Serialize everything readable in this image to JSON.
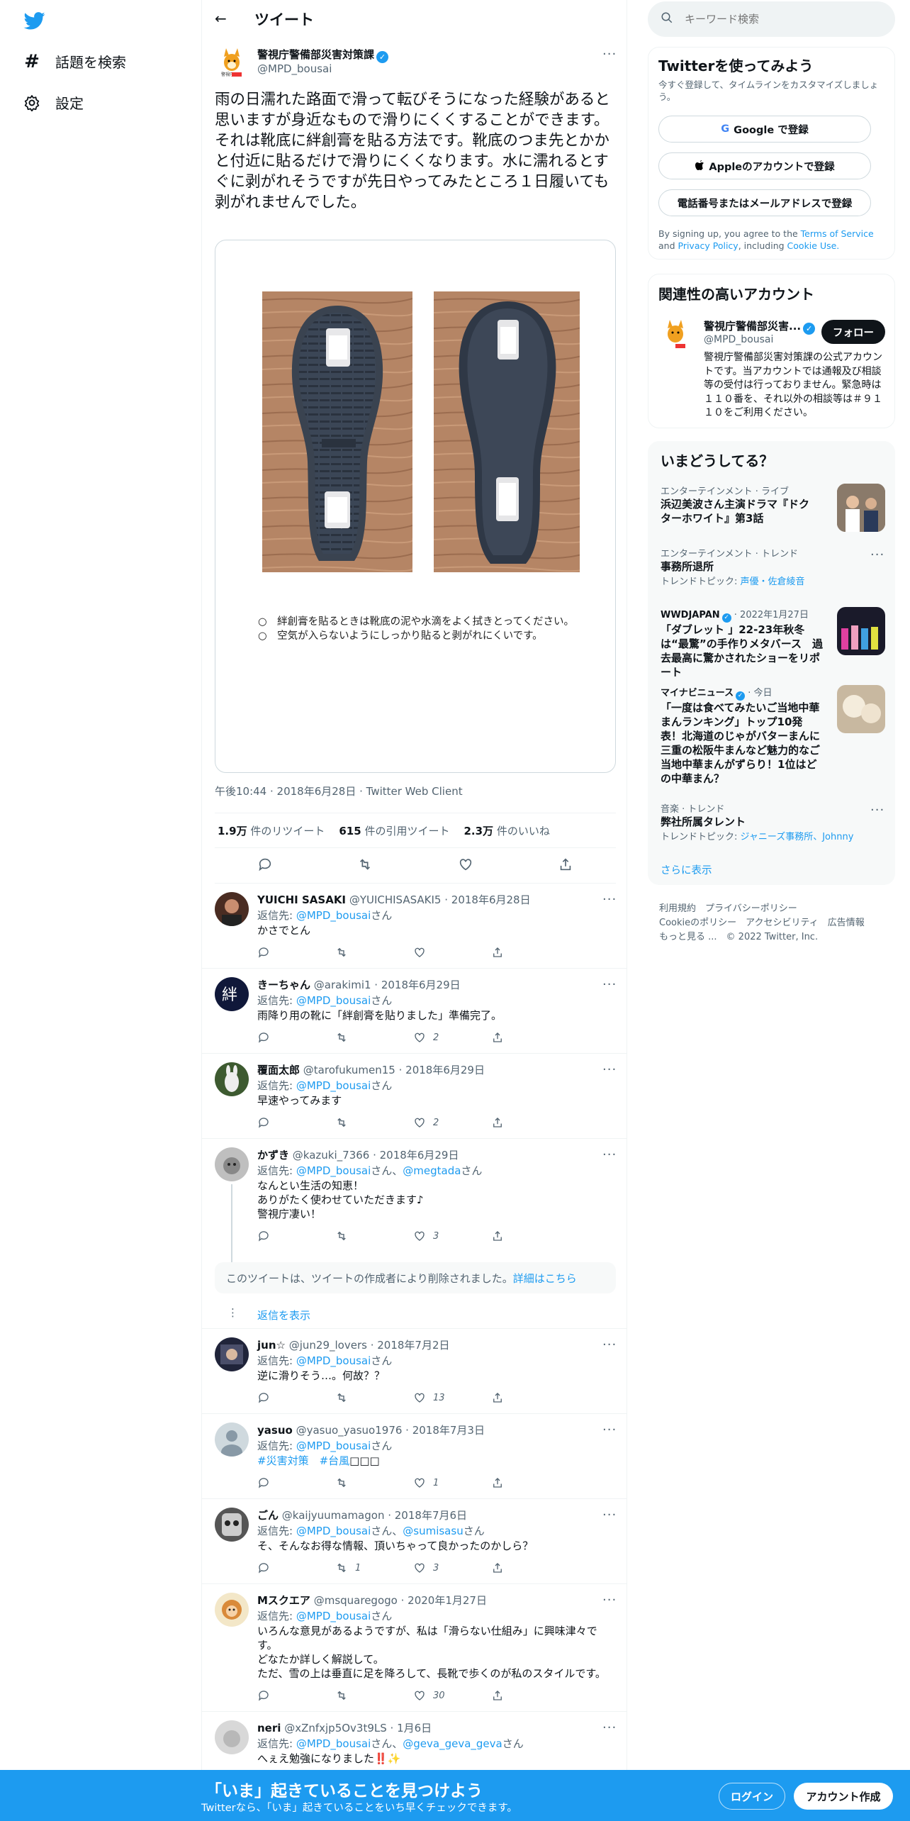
{
  "nav": {
    "explore_label": "話題を検索",
    "settings_label": "設定"
  },
  "header": {
    "title": "ツイート"
  },
  "tweet": {
    "author_name": "警視庁警備部災害対策課",
    "author_handle": "@MPD_bousai",
    "text": "雨の日濡れた路面で滑って転びそうになった経験があると思いますが身近なもので滑りにくくすることができます。それは靴底に絆創膏を貼る方法です。靴底のつま先とかかと付近に貼るだけで滑りにくくなります。水に濡れるとすぐに剥がれそうですが先日やってみたところ１日履いても剥がれませんでした。",
    "image_notes": [
      "○　絆創膏を貼るときは靴底の泥や水滴をよく拭きとってください。",
      "○　空気が入らないようにしっかり貼ると剥がれにくいです。"
    ],
    "meta": "午後10:44 · 2018年6月28日 · Twitter Web Client",
    "retweets_count": "1.9万",
    "retweets_label": "件のリツイート",
    "quotes_count": "615",
    "quotes_label": "件の引用ツイート",
    "likes_count": "2.3万",
    "likes_label": "件のいいね"
  },
  "replies": [
    {
      "name": "YUICHI SASAKI",
      "handle": "@YUICHISASAKI5",
      "date": "2018年6月28日",
      "to_prefix": "返信先: ",
      "to": "@MPD_bousai",
      "to_suffix": "さん",
      "text": "かさでとん",
      "reply_count": "",
      "rt_count": "",
      "like_count": ""
    },
    {
      "name": "きーちゃん",
      "handle": "@arakimi1",
      "date": "2018年6月29日",
      "to_prefix": "返信先: ",
      "to": "@MPD_bousai",
      "to_suffix": "さん",
      "text": "雨降り用の靴に「絆創膏を貼りました」準備完了。",
      "reply_count": "",
      "rt_count": "",
      "like_count": "2"
    },
    {
      "name": "覆面太郎",
      "handle": "@tarofukumen15",
      "date": "2018年6月29日",
      "to_prefix": "返信先: ",
      "to": "@MPD_bousai",
      "to_suffix": "さん",
      "text": "早速やってみます",
      "reply_count": "",
      "rt_count": "",
      "like_count": "2"
    },
    {
      "name": "かずき",
      "handle": "@kazuki_7366",
      "date": "2018年6月29日",
      "to_prefix": "返信先: ",
      "to": "@MPD_bousai",
      "to_mid": "さん、",
      "to2": "@megtada",
      "to_suffix": "さん",
      "text_lines": [
        "なんとい生活の知恵！",
        "ありがたく使わせていただきます♪",
        "警視庁凄い！"
      ],
      "reply_count": "",
      "rt_count": "",
      "like_count": "3"
    },
    {
      "name": "jun☆",
      "handle": "@jun29_lovers",
      "date": "2018年7月2日",
      "to_prefix": "返信先: ",
      "to": "@MPD_bousai",
      "to_suffix": "さん",
      "text": "逆に滑りそう…。何故？？",
      "reply_count": "",
      "rt_count": "",
      "like_count": "13"
    },
    {
      "name": "yasuo",
      "handle": "@yasuo_yasuo1976",
      "date": "2018年7月3日",
      "to_prefix": "返信先: ",
      "to": "@MPD_bousai",
      "to_suffix": "さん",
      "tag1": "#災害対策",
      "tag2": "#台風",
      "tag_tail": "□□□",
      "reply_count": "",
      "rt_count": "",
      "like_count": "1"
    },
    {
      "name": "ごん",
      "handle": "@kaijyuumamagon",
      "date": "2018年7月6日",
      "to_prefix": "返信先: ",
      "to": "@MPD_bousai",
      "to_mid": "さん、",
      "to2": "@sumisasu",
      "to_suffix": "さん",
      "text": "そ、そんなお得な情報、頂いちゃって良かったのかしら？",
      "reply_count": "",
      "rt_count": "1",
      "like_count": "3"
    },
    {
      "name": "Mスクエア",
      "handle": "@msquaregogo",
      "date": "2020年1月27日",
      "to_prefix": "返信先: ",
      "to": "@MPD_bousai",
      "to_suffix": "さん",
      "text_lines": [
        "いろんな意見があるようですが、私は「滑らない仕組み」に興味津々で",
        "す。",
        "どなたか詳しく解説して。",
        "ただ、雪の上は垂直に足を降ろして、長靴で歩くのが私のスタイルです。"
      ],
      "reply_count": "",
      "rt_count": "",
      "like_count": "30"
    },
    {
      "name": "neri",
      "handle": "@xZnfxjp5Ov3t9LS",
      "date": "1月6日",
      "to_prefix": "返信先: ",
      "to": "@MPD_bousai",
      "to_mid": "さん、",
      "to2": "@geva_geva_geva",
      "to_suffix": "さん",
      "text": "へぇえ勉強になりました‼️✨"
    }
  ],
  "deleted_notice": {
    "text": "このツイートは、ツイートの作成者により削除されました。",
    "link": "詳細はこちら"
  },
  "show_replies": "返信を表示",
  "sidebar": {
    "search_placeholder": "キーワード検索",
    "signup": {
      "title": "Twitterを使ってみよう",
      "subtitle": "今すぐ登録して、タイムラインをカスタマイズしましょう。",
      "google": "Google で登録",
      "apple": "Appleのアカウントで登録",
      "phone": "電話番号またはメールアドレスで登録",
      "terms_prefix": "By signing up, you agree to the ",
      "terms": "Terms of Service",
      "and": " and ",
      "privacy": "Privacy Policy",
      "including": ", including ",
      "cookie": "Cookie Use."
    },
    "related": {
      "title": "関連性の高いアカウント",
      "name": "警視庁警備部災害...",
      "handle": "@MPD_bousai",
      "follow": "フォロー",
      "bio": "警視庁警備部災害対策課の公式アカウントです。当アカウントでは通報及び相談等の受付は行っておりません。緊急時は１１０番を、それ以外の相談等は＃９１１０をご利用ください。"
    },
    "trends": {
      "title": "いまどうしてる？",
      "items": [
        {
          "cat": "エンターテインメント · ライブ",
          "title": "浜辺美波さん主演ドラマ『ドクターホワイト』第3話"
        },
        {
          "cat": "エンターテインメント · トレンド",
          "title": "事務所退所",
          "sub_prefix": "トレンドトピック: ",
          "sub": "声優・佐倉綾音"
        },
        {
          "cat": "WWDJAPAN",
          "cat_time": " · 2022年1月27日",
          "title": "「ダブレット 」22-23年秋冬は“最驚”の手作りメタバース　過去最高に驚かされたショーをリポート"
        },
        {
          "cat": "マイナビニュース",
          "cat_time": " · 今日",
          "title": "「一度は食べてみたいご当地中華まんランキング」トップ10発表！北海道のじゃがバターまんに三重の松阪牛まんなど魅力的なご当地中華まんがずらり！1位はどの中華まん？"
        },
        {
          "cat": "音楽 · トレンド",
          "title": "弊社所属タレント",
          "sub_prefix": "トレンドトピック: ",
          "sub": "ジャニーズ事務所、Johnny"
        }
      ],
      "more": "さらに表示"
    },
    "footer": {
      "l1": "利用規約",
      "l2": "プライバシーポリシー",
      "l3": "Cookieのポリシー",
      "l4": "アクセシビリティ",
      "l5": "広告情報",
      "l6": "もっと見る ...",
      "copy": "© 2022 Twitter, Inc."
    }
  },
  "bottom_bar": {
    "title": "「いま」起きていることを見つけよう",
    "subtitle": "Twitterなら、「いま」起きていることをいち早くチェックできます。",
    "login": "ログイン",
    "signup": "アカウント作成"
  },
  "colors": {
    "accent": "#1d9bf0",
    "text": "#0f1419",
    "muted": "#536471",
    "border": "#eff3f4"
  }
}
